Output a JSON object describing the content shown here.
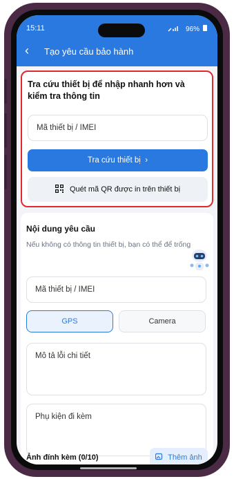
{
  "status_bar": {
    "time": "15:11",
    "battery": "96%"
  },
  "header": {
    "title": "Tạo yêu cầu bảo hành"
  },
  "lookup": {
    "heading": "Tra cứu thiết bị để nhập nhanh hơn và kiểm tra thông tin",
    "device_placeholder": "Mã thiết bị / IMEI",
    "lookup_button": "Tra cứu thiết bị",
    "qr_button": "Quét mã QR được in trên thiết bị"
  },
  "request": {
    "heading": "Nội dung yêu cầu",
    "hint": "Nếu không có thông tin thiết bị, bạn có thể để trống",
    "device_placeholder": "Mã thiết bị / IMEI",
    "tabs": [
      "GPS",
      "Camera"
    ],
    "selected_tab": "GPS",
    "description_placeholder": "Mô tả lỗi chi tiết",
    "accessories_placeholder": "Phụ kiện đi kèm",
    "attachments_label": "Ảnh đính kèm (0/10)",
    "add_photo_button": "Thêm ảnh"
  },
  "colors": {
    "primary": "#2a79e0",
    "highlight_border": "#e2282f"
  }
}
